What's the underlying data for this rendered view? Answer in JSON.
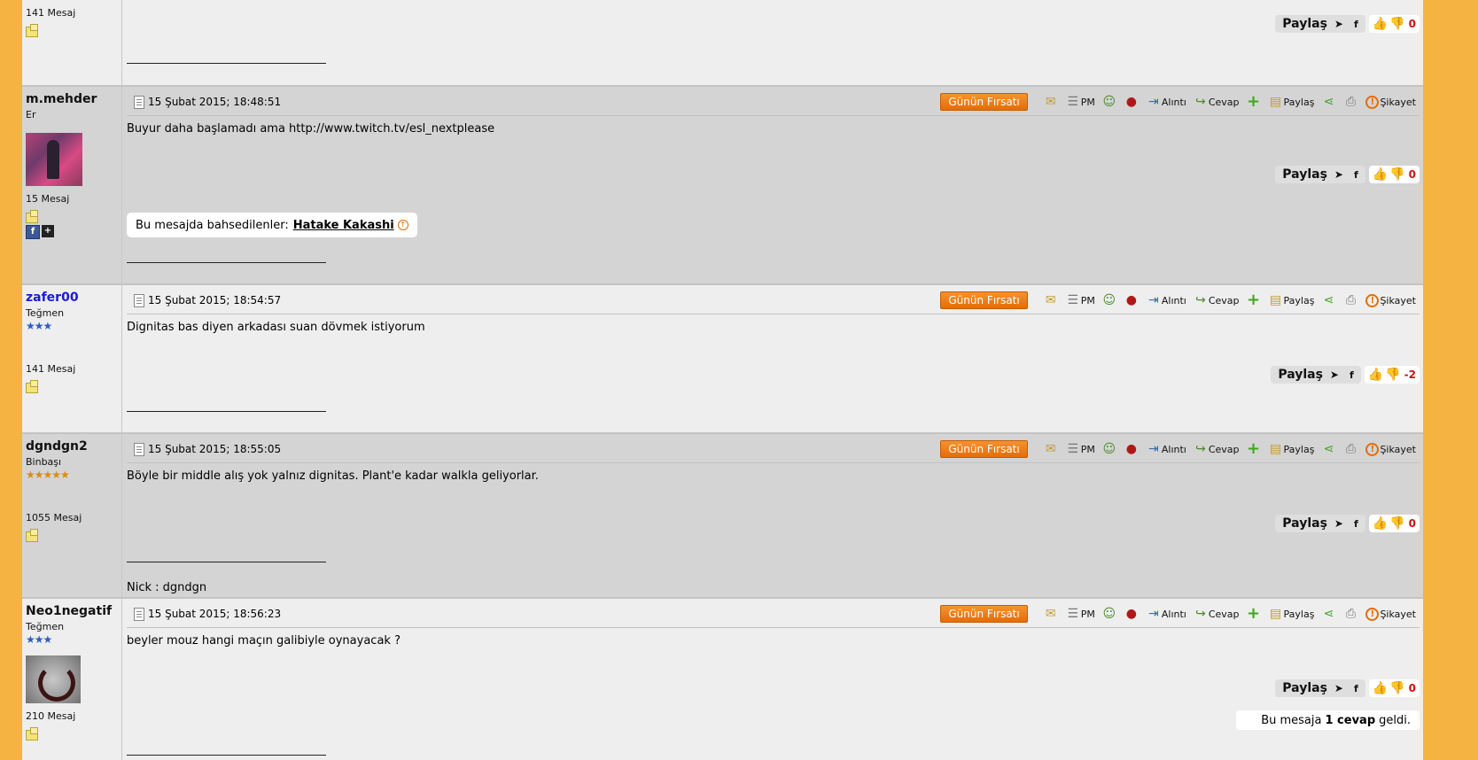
{
  "toolbar": {
    "deal": "Günün Fırsatı",
    "pm": "PM",
    "quote": "Alıntı",
    "reply": "Cevap",
    "share": "Paylaş",
    "report": "Şikayet"
  },
  "share": {
    "label": "Paylaş"
  },
  "signature_char": "____________________________",
  "posts": [
    {
      "count": "141 Mesaj",
      "score": "0"
    },
    {
      "user": "m.mehder",
      "rank": "Er",
      "count": "15 Mesaj",
      "date": "15 Şubat 2015; 18:48:51",
      "message": "Buyur daha başlamadı ama http://www.twitch.tv/esl_nextplease",
      "score": "0",
      "mentions_label": "Bu mesajda bahsedilenler:",
      "mentions_user": "Hatake Kakashi"
    },
    {
      "user": "zafer00",
      "rank": "Teğmen",
      "stars": "★★★",
      "count": "141 Mesaj",
      "date": "15 Şubat 2015; 18:54:57",
      "message": "Dignitas bas diyen arkadası suan dövmek istiyorum",
      "score": "-2"
    },
    {
      "user": "dgndgn2",
      "rank": "Binbaşı",
      "stars": "★★★★★",
      "count": "1055 Mesaj",
      "date": "15 Şubat 2015; 18:55:05",
      "message": "Böyle bir middle alış yok yalnız dignitas. Plant'e kadar walkla geliyorlar.",
      "score": "0",
      "nick": "Nick : dgndgn"
    },
    {
      "user": "Neo1negatif",
      "rank": "Teğmen",
      "stars": "★★★",
      "count": "210 Mesaj",
      "date": "15 Şubat 2015; 18:56:23",
      "message": "beyler mouz hangi maçın galibiyle oynayacak ?",
      "score": "0",
      "replies_pre": "Bu mesaja",
      "replies_count": "1 cevap",
      "replies_post": "geldi."
    }
  ]
}
